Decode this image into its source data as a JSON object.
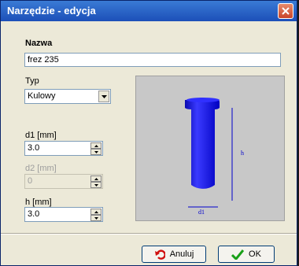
{
  "window": {
    "title": "Narzędzie - edycja"
  },
  "name": {
    "label": "Nazwa",
    "value": "frez 235"
  },
  "type": {
    "label": "Typ",
    "value": "Kulowy"
  },
  "d1": {
    "label": "d1 [mm]",
    "value": "3.0"
  },
  "d2": {
    "label": "d2 [mm]",
    "value": "0"
  },
  "h": {
    "label": "h [mm]",
    "value": "3.0"
  },
  "preview": {
    "label_h": "h",
    "label_d1": "d1",
    "tool_color": "#1010ee"
  },
  "buttons": {
    "cancel": "Anuluj",
    "ok": "OK"
  },
  "icons": {
    "close": "close-icon",
    "undo": "undo-icon",
    "check": "check-icon"
  }
}
